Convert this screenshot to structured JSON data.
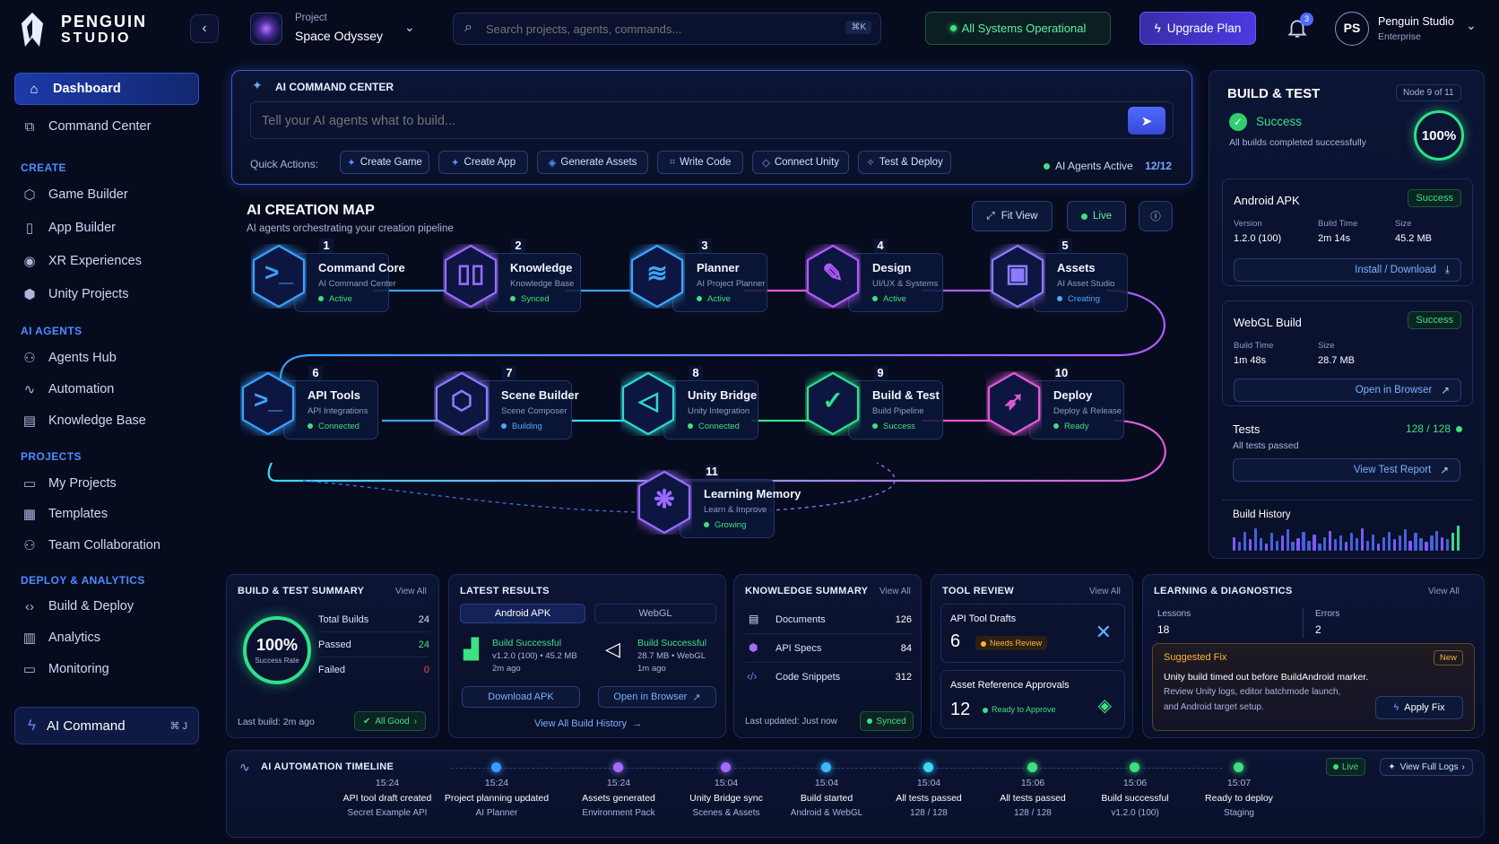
{
  "brand": {
    "line1": "PENGUIN",
    "line2": "STUDIO"
  },
  "header": {
    "project_label": "Project",
    "project_name": "Space Odyssey",
    "search_placeholder": "Search projects, agents, commands...",
    "search_shortcut": "⌘K",
    "status": "All Systems Operational",
    "upgrade": "Upgrade Plan",
    "notif_count": "3",
    "avatar": "PS",
    "user_name": "Penguin Studio",
    "user_plan": "Enterprise"
  },
  "sidebar": {
    "top": [
      {
        "label": "Dashboard",
        "icon": "home-icon"
      },
      {
        "label": "Command Center",
        "icon": "terminal-icon"
      }
    ],
    "sections": [
      {
        "title": "CREATE",
        "items": [
          "Game Builder",
          "App Builder",
          "XR Experiences",
          "Unity Projects"
        ]
      },
      {
        "title": "AI AGENTS",
        "items": [
          "Agents Hub",
          "Automation",
          "Knowledge Base"
        ]
      },
      {
        "title": "PROJECTS",
        "items": [
          "My Projects",
          "Templates",
          "Team Collaboration"
        ]
      },
      {
        "title": "DEPLOY & ANALYTICS",
        "items": [
          "Build & Deploy",
          "Analytics",
          "Monitoring"
        ]
      }
    ],
    "ai_command": {
      "label": "AI Command",
      "shortcut": "⌘ J"
    }
  },
  "command_center": {
    "title": "AI COMMAND CENTER",
    "placeholder": "Tell your AI agents what to build...",
    "quick_label": "Quick Actions:",
    "quick": [
      "Create Game",
      "Create App",
      "Generate Assets",
      "Write Code",
      "Connect Unity",
      "Test & Deploy"
    ],
    "agents_label": "AI Agents Active",
    "agents_count": "12/12"
  },
  "map": {
    "title": "AI CREATION MAP",
    "subtitle": "AI agents orchestrating your creation pipeline",
    "fit": "Fit View",
    "live": "Live",
    "nodes": [
      {
        "n": "1",
        "title": "Command Core",
        "sub": "AI Command Center",
        "status": "Active",
        "sc": "#3ee07f",
        "color": "#3aa0ff",
        "glyph": ">_"
      },
      {
        "n": "2",
        "title": "Knowledge",
        "sub": "Knowledge Base",
        "status": "Synced",
        "sc": "#3ee07f",
        "color": "#9a6bff",
        "glyph": "▯▯"
      },
      {
        "n": "3",
        "title": "Planner",
        "sub": "AI Project Planner",
        "status": "Active",
        "sc": "#3ee07f",
        "color": "#3fa6ff",
        "glyph": "≋"
      },
      {
        "n": "4",
        "title": "Design",
        "sub": "UI/UX & Systems",
        "status": "Active",
        "sc": "#3ee07f",
        "color": "#b05bff",
        "glyph": "✎"
      },
      {
        "n": "5",
        "title": "Assets",
        "sub": "AI Asset Studio",
        "status": "Creating",
        "sc": "#4aa8ff",
        "color": "#8c7bff",
        "glyph": "▣"
      },
      {
        "n": "6",
        "title": "API Tools",
        "sub": "API Integrations",
        "status": "Connected",
        "sc": "#3ee07f",
        "color": "#3aa0ff",
        "glyph": ">_"
      },
      {
        "n": "7",
        "title": "Scene Builder",
        "sub": "Scene Composer",
        "status": "Building",
        "sc": "#4aa8ff",
        "color": "#8c7bff",
        "glyph": "⬡"
      },
      {
        "n": "8",
        "title": "Unity Bridge",
        "sub": "Unity Integration",
        "status": "Connected",
        "sc": "#3ee07f",
        "color": "#2fd8d0",
        "glyph": "◁"
      },
      {
        "n": "9",
        "title": "Build & Test",
        "sub": "Build Pipeline",
        "status": "Success",
        "sc": "#3ee07f",
        "color": "#2fe08a",
        "glyph": "✓"
      },
      {
        "n": "10",
        "title": "Deploy",
        "sub": "Deploy & Release",
        "status": "Ready",
        "sc": "#3ee07f",
        "color": "#e05bd8",
        "glyph": "➶"
      },
      {
        "n": "11",
        "title": "Learning Memory",
        "sub": "Learn & Improve",
        "status": "Growing",
        "sc": "#3ee07f",
        "color": "#9a6bff",
        "glyph": "❋"
      }
    ]
  },
  "build_test": {
    "title": "BUILD & TEST",
    "node": "Node 9 of 11",
    "status": "Success",
    "desc": "All builds completed successfully",
    "pct": "100%",
    "android": {
      "title": "Android APK",
      "badge": "Success",
      "k1": "Version",
      "v1": "1.2.0 (100)",
      "k2": "Build Time",
      "v2": "2m 14s",
      "k3": "Size",
      "v3": "45.2 MB",
      "btn": "Install / Download"
    },
    "webgl": {
      "title": "WebGL Build",
      "badge": "Success",
      "k1": "Build Time",
      "v1": "1m 48s",
      "k2": "Size",
      "v2": "28.7 MB",
      "btn": "Open in Browser"
    },
    "tests": {
      "title": "Tests",
      "count": "128 / 128",
      "desc": "All tests passed",
      "btn": "View Test Report"
    },
    "history": {
      "title": "Build History",
      "values": [
        0.55,
        0.35,
        0.75,
        0.45,
        0.9,
        0.5,
        0.3,
        0.7,
        0.4,
        0.6,
        0.85,
        0.35,
        0.5,
        0.75,
        0.4,
        0.65,
        0.3,
        0.55,
        0.8,
        0.45,
        0.6,
        0.35,
        0.7,
        0.5,
        0.9,
        0.4,
        0.65,
        0.3,
        0.55,
        0.75,
        0.45,
        0.6,
        0.85,
        0.4,
        0.7,
        0.5,
        0.35,
        0.6,
        0.8,
        0.55,
        0.45,
        0.7,
        1.0
      ]
    }
  },
  "summary": {
    "title": "BUILD & TEST SUMMARY",
    "view": "View All",
    "pct": "100%",
    "rate": "Success Rate",
    "rows": [
      {
        "k": "Total Builds",
        "v": "24",
        "c": "#dbe4ff"
      },
      {
        "k": "Passed",
        "v": "24",
        "c": "#3ee07f"
      },
      {
        "k": "Failed",
        "v": "0",
        "c": "#ff4a4a"
      }
    ],
    "last": "Last build: 2m ago",
    "good": "All Good"
  },
  "latest": {
    "title": "LATEST RESULTS",
    "tab1": "Android APK",
    "tab2": "WebGL",
    "a_status": "Build Successful",
    "a_meta": "v1.2.0 (100) • 45.2 MB",
    "a_time": "2m ago",
    "a_btn": "Download APK",
    "w_status": "Build Successful",
    "w_meta": "28.7 MB • WebGL",
    "w_time": "1m ago",
    "w_btn": "Open in Browser",
    "history": "View All Build History"
  },
  "knowledge": {
    "title": "KNOWLEDGE SUMMARY",
    "view": "View All",
    "rows": [
      {
        "k": "Documents",
        "v": "126"
      },
      {
        "k": "API Specs",
        "v": "84"
      },
      {
        "k": "Code Snippets",
        "v": "312"
      }
    ],
    "updated": "Last updated: Just now",
    "synced": "Synced"
  },
  "tool": {
    "title": "TOOL REVIEW",
    "view": "View All",
    "c1_title": "API Tool Drafts",
    "c1_num": "6",
    "c1_badge": "Needs Review",
    "c2_title": "Asset Reference Approvals",
    "c2_num": "12",
    "c2_badge": "Ready to Approve"
  },
  "diag": {
    "title": "LEARNING & DIAGNOSTICS",
    "view": "View All",
    "lessons_k": "Lessons",
    "lessons_v": "18",
    "errors_k": "Errors",
    "errors_v": "2",
    "fix_title": "Suggested Fix",
    "fix_badge": "New",
    "fix_line1": "Unity build timed out before BuildAndroid marker.",
    "fix_line2": "Review Unity logs, editor batchmode launch,",
    "fix_line3": "and Android target setup.",
    "apply": "Apply Fix"
  },
  "timeline": {
    "title": "AI AUTOMATION TIMELINE",
    "live": "Live",
    "full": "View Full Logs",
    "events": [
      {
        "time": "15:24",
        "title": "API tool draft created",
        "sub": "Secret Example API",
        "color": ""
      },
      {
        "time": "15:24",
        "title": "Project planning updated",
        "sub": "AI Planner",
        "color": "#3a9cff"
      },
      {
        "time": "15:24",
        "title": "Assets generated",
        "sub": "Environment Pack",
        "color": "#a36bff"
      },
      {
        "time": "15:04",
        "title": "Unity Bridge sync",
        "sub": "Scenes & Assets",
        "color": "#a36bff"
      },
      {
        "time": "15:04",
        "title": "Build started",
        "sub": "Android & WebGL",
        "color": "#3ab8ff"
      },
      {
        "time": "15:04",
        "title": "All tests passed",
        "sub": "128 / 128",
        "color": "#3ad8ff"
      },
      {
        "time": "15:06",
        "title": "All tests passed",
        "sub": "128 / 128",
        "color": "#3ee07f"
      },
      {
        "time": "15:06",
        "title": "Build successful",
        "sub": "v1.2.0 (100)",
        "color": "#3ee07f"
      },
      {
        "time": "15:07",
        "title": "Ready to deploy",
        "sub": "Staging",
        "color": "#3ee07f"
      }
    ]
  }
}
